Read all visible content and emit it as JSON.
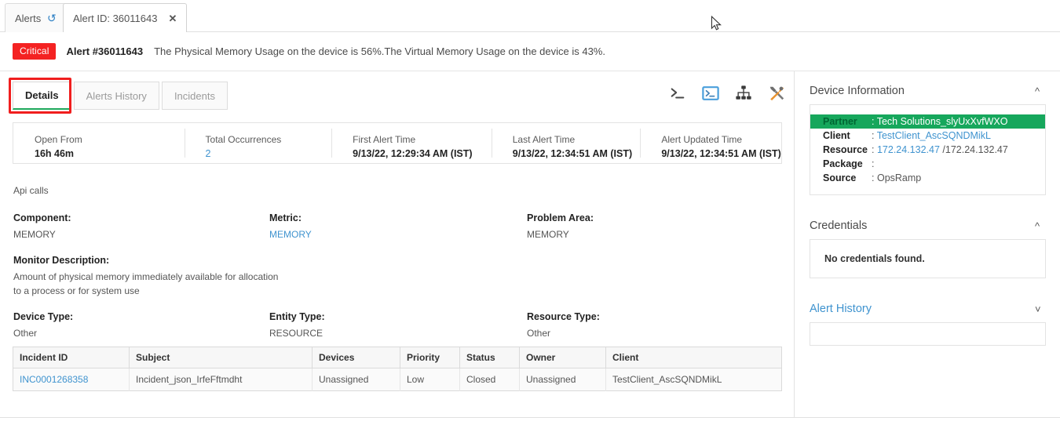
{
  "tabs": {
    "alerts_label": "Alerts",
    "refresh_icon": "refresh-icon",
    "alert_tab_label": "Alert ID: 36011643",
    "close_icon": "close-icon"
  },
  "banner": {
    "severity": "Critical",
    "alert_id": "Alert #36011643",
    "message": "The Physical Memory Usage on the device is 56%.The Virtual Memory Usage on the device is 43%."
  },
  "subtabs": [
    {
      "label": "Details",
      "active": true
    },
    {
      "label": "Alerts History",
      "active": false
    },
    {
      "label": "Incidents",
      "active": false
    }
  ],
  "toolbar_icons": [
    {
      "name": "terminal-prompt-icon"
    },
    {
      "name": "console-box-icon"
    },
    {
      "name": "topology-icon"
    },
    {
      "name": "tools-icon"
    }
  ],
  "summary": [
    {
      "label": "Open From",
      "value": "16h 46m",
      "link": false
    },
    {
      "label": "Total Occurrences",
      "value": "2",
      "link": true
    },
    {
      "label": "First Alert Time",
      "value": "9/13/22, 12:29:34 AM (IST)",
      "link": false
    },
    {
      "label": "Last Alert Time",
      "value": "9/13/22, 12:34:51 AM (IST)",
      "link": false
    },
    {
      "label": "Alert Updated Time",
      "value": "9/13/22, 12:34:51 AM (IST)",
      "link": false
    }
  ],
  "api_calls_label": "Api calls",
  "fields": {
    "component_label": "Component:",
    "component_value": "MEMORY",
    "metric_label": "Metric:",
    "metric_value": "MEMORY",
    "problem_area_label": "Problem Area:",
    "problem_area_value": "MEMORY",
    "monitor_desc_label": "Monitor Description:",
    "monitor_desc_line1": "Amount of physical memory immediately available for allocation",
    "monitor_desc_line2": "to a process or for system use",
    "device_type_label": "Device Type:",
    "device_type_value": "Other",
    "entity_type_label": "Entity Type:",
    "entity_type_value": "RESOURCE",
    "resource_type_label": "Resource Type:",
    "resource_type_value": "Other"
  },
  "incidents_table": {
    "columns": [
      "Incident ID",
      "Subject",
      "Devices",
      "Priority",
      "Status",
      "Owner",
      "Client"
    ],
    "rows": [
      {
        "incident_id": "INC0001268358",
        "subject": "Incident_json_IrfeFftmdht",
        "devices": "Unassigned",
        "priority": "Low",
        "status": "Closed",
        "owner": "Unassigned",
        "client": "TestClient_AscSQNDMikL"
      }
    ]
  },
  "sidebar": {
    "device_information": {
      "title": "Device Information",
      "collapse_icon": "chevron-up-icon",
      "rows": [
        {
          "label": "Partner",
          "sep": ":",
          "value": "Tech Solutions_slyUxXvfWXO",
          "highlight": true,
          "link": true
        },
        {
          "label": "Client",
          "sep": ":",
          "value": "TestClient_AscSQNDMikL",
          "highlight": false,
          "link": true
        },
        {
          "label": "Resource",
          "sep": ":",
          "value": "172.24.132.47",
          "value2": "/172.24.132.47",
          "highlight": false,
          "link": true
        },
        {
          "label": "Package",
          "sep": ":",
          "value": "",
          "highlight": false,
          "link": false
        },
        {
          "label": "Source",
          "sep": ":",
          "value": "OpsRamp",
          "highlight": false,
          "link": false
        }
      ]
    },
    "credentials": {
      "title": "Credentials",
      "collapse_icon": "chevron-up-icon",
      "empty_text": "No credentials found."
    },
    "alert_history": {
      "title": "Alert History",
      "expand_icon": "chevron-down-icon"
    }
  },
  "colors": {
    "critical": "#f42222",
    "link": "#3f93cf",
    "highlight_green": "#16a75c",
    "tab_underline": "#1fa85c",
    "focus_outline": "#f01e1e"
  }
}
